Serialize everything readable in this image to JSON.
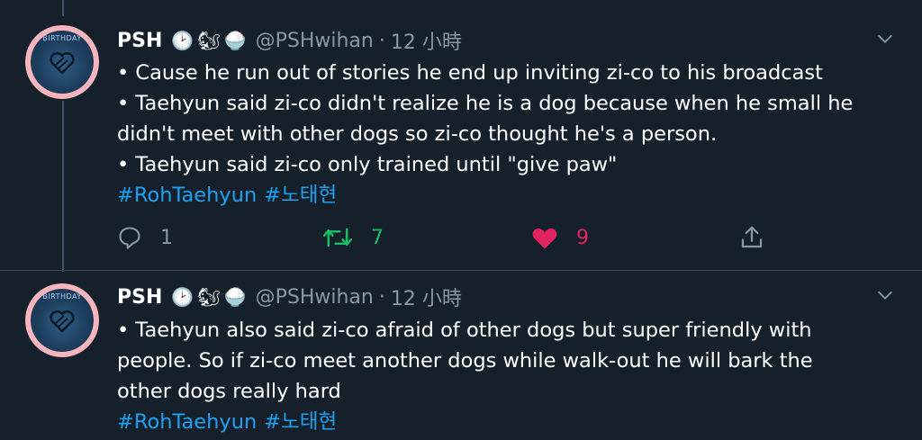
{
  "tweets": [
    {
      "author_name": "PSH",
      "emojis": [
        "🕑",
        "🐿",
        "🍚"
      ],
      "handle": "@PSHwihan",
      "separator": "·",
      "time": "12 小時",
      "lines": [
        "• Cause he run out of stories he end up inviting zi-co to his broadcast",
        "• Taehyun said zi-co didn't realize he is a dog because when he small he",
        "didn't meet with other dogs so zi-co thought he's a person.",
        "• Taehyun said zi-co only trained until \"give paw\""
      ],
      "hashtags": [
        "#RohTaehyun",
        "#노태현"
      ],
      "reply_count": "1",
      "retweet_count": "7",
      "like_count": "9"
    },
    {
      "author_name": "PSH",
      "emojis": [
        "🕑",
        "🐿",
        "🍚"
      ],
      "handle": "@PSHwihan",
      "separator": "·",
      "time": "12 小時",
      "lines": [
        "• Taehyun also said zi-co afraid of other dogs but super friendly with",
        "people. So if zi-co meet another dogs while walk-out he will bark the",
        "other dogs really hard"
      ],
      "hashtags": [
        "#RohTaehyun",
        "#노태현"
      ]
    }
  ],
  "colors": {
    "background": "#15202b",
    "muted": "#8899a6",
    "link": "#1da1f2",
    "retweet": "#17bf63",
    "like": "#e0245e"
  },
  "icons": [
    "chevron-down-icon",
    "reply-icon",
    "retweet-icon",
    "heart-icon",
    "share-icon"
  ]
}
